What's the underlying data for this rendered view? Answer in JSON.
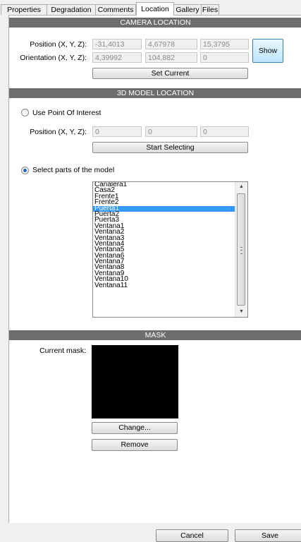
{
  "tabs": [
    "Properties",
    "Degradation",
    "Comments",
    "Location",
    "Gallery",
    "Files"
  ],
  "active_tab": "Location",
  "camera": {
    "header": "CAMERA LOCATION",
    "position_label": "Position (X, Y, Z):",
    "position": [
      "-31,4013",
      "4,67978",
      "15,3795"
    ],
    "orientation_label": "Orientation (X, Y, Z):",
    "orientation": [
      "4,39992",
      "104,882",
      "0"
    ],
    "show_button": "Show",
    "set_current_button": "Set Current"
  },
  "model": {
    "header": "3D MODEL LOCATION",
    "use_poi_label": "Use Point Of Interest",
    "use_poi_selected": false,
    "position_label": "Position (X, Y, Z):",
    "position": [
      "0",
      "0",
      "0"
    ],
    "start_selecting_button": "Start Selecting",
    "select_parts_label": "Select parts of the model",
    "select_parts_selected": true,
    "parts": [
      "Canalera1",
      "Casa2",
      "Frente1",
      "Frente2",
      "Puerta1",
      "Puerta2",
      "Puerta3",
      "Ventana1",
      "Ventana2",
      "Ventana3",
      "Ventana4",
      "Ventana5",
      "Ventana6",
      "Ventana7",
      "Ventana8",
      "Ventana9",
      "Ventana10",
      "Ventana11"
    ],
    "selected_part": "Puerta1"
  },
  "mask": {
    "header": "MASK",
    "current_label": "Current mask:",
    "change_button": "Change...",
    "remove_button": "Remove"
  },
  "footer": {
    "cancel_button": "Cancel",
    "save_button": "Save"
  },
  "colors": {
    "header_bg": "#6d6d6d",
    "selection": "#3399ff",
    "radio_dot": "#2a63c7"
  }
}
